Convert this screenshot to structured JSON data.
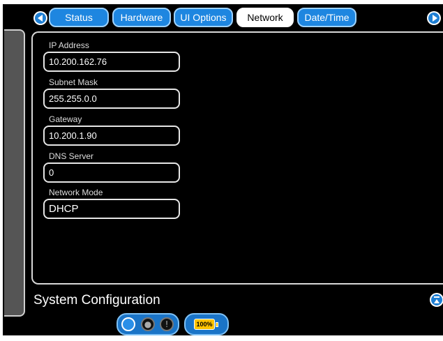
{
  "tabs": [
    {
      "label": "Status",
      "active": false
    },
    {
      "label": "Hardware",
      "active": false
    },
    {
      "label": "UI Options",
      "active": false
    },
    {
      "label": "Network",
      "active": true
    },
    {
      "label": "Date/Time",
      "active": false
    }
  ],
  "fields": {
    "ip_address": {
      "label": "IP Address",
      "value": "10.200.162.76"
    },
    "subnet_mask": {
      "label": "Subnet Mask",
      "value": "255.255.0.0"
    },
    "gateway": {
      "label": "Gateway",
      "value": "10.200.1.90"
    },
    "dns_server": {
      "label": "DNS Server",
      "value": "0"
    },
    "network_mode": {
      "label": "Network Mode",
      "value": "DHCP"
    }
  },
  "footer": {
    "title": "System Configuration"
  },
  "status_bar": {
    "battery_label": "100%",
    "battery_level": 1.0
  },
  "colors": {
    "accent": "#1e86e0",
    "tab_border": "#9fd3ff",
    "battery": "#ffc400",
    "background": "#000000"
  },
  "icons": {
    "prev": "chevron-left-icon",
    "next": "chevron-right-icon",
    "collapse": "collapse-icon",
    "lock": "lock-icon",
    "alert": "alert-icon",
    "battery": "battery-icon"
  }
}
